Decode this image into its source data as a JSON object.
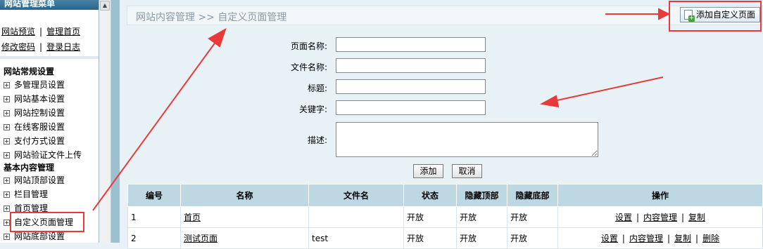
{
  "sidebar": {
    "title": "网站管理菜单",
    "quick_links": [
      {
        "label": "网站预览"
      },
      {
        "label": "管理首页"
      },
      {
        "label": "修改密码"
      },
      {
        "label": "登录日志"
      }
    ],
    "sections": [
      {
        "title": "网站常规设置",
        "items": [
          "多管理员设置",
          "网站基本设置",
          "网站控制设置",
          "在线客服设置",
          "支付方式设置",
          "网站验证文件上传"
        ]
      },
      {
        "title": "基本内容管理",
        "items": [
          "网站顶部设置",
          "栏目管理",
          "首页管理",
          "自定义页面管理",
          "网站底部设置"
        ]
      }
    ]
  },
  "header": {
    "breadcrumb": "网站内容管理  >> 自定义页面管理",
    "add_button": "添加自定义页面"
  },
  "form": {
    "page_name_label": "页面名称:",
    "file_name_label": "文件名称:",
    "title_label": "标题:",
    "keywords_label": "关键字:",
    "description_label": "描述:",
    "submit_label": "添加",
    "cancel_label": "取消"
  },
  "table": {
    "headers": [
      "编号",
      "名称",
      "文件名",
      "状态",
      "隐藏顶部",
      "隐藏底部",
      "操作"
    ],
    "rows": [
      {
        "id": "1",
        "name": "首页",
        "file": "",
        "status": "开放",
        "hide_top": "开放",
        "hide_bottom": "开放",
        "ops": [
          "设置",
          "内容管理",
          "复制"
        ]
      },
      {
        "id": "2",
        "name": "测试页面",
        "file": "test",
        "status": "开放",
        "hide_top": "开放",
        "hide_bottom": "开放",
        "ops": [
          "设置",
          "内容管理",
          "复制",
          "删除"
        ]
      }
    ]
  },
  "colors": {
    "highlight": "#e83a3a",
    "header_bg": "#bed8e3"
  }
}
